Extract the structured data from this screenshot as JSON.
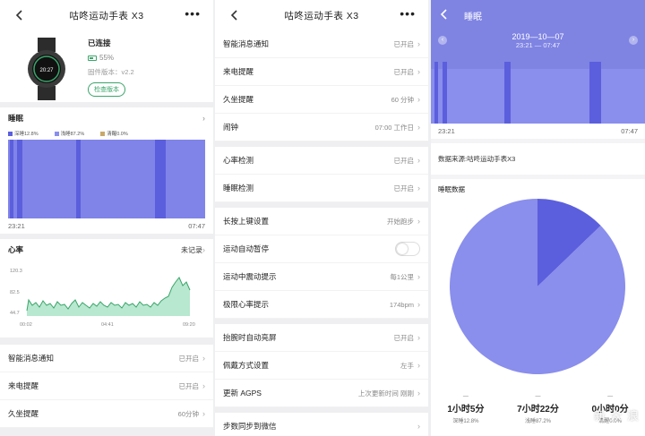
{
  "screen1": {
    "title": "咕咚运动手表 X3",
    "device": {
      "status": "已连接",
      "battery": "55%",
      "firmware": "固件版本：v2.2",
      "check_button": "检查版本",
      "watch_time": "20:27"
    },
    "sleep": {
      "title": "睡眠",
      "legend": [
        "深睡12.8%",
        "浅睡87.2%",
        "清醒0.0%"
      ],
      "start": "23:21",
      "end": "07:47"
    },
    "heart": {
      "title": "心率",
      "status": "未记录",
      "y_top": "120.3",
      "y_mid": "82.5",
      "y_low": "44.7",
      "x_ticks": [
        "00:02",
        "04:41",
        "09:20"
      ]
    },
    "rows": [
      {
        "label": "智能消息通知",
        "value": "已开启"
      },
      {
        "label": "来电提醒",
        "value": "已开启"
      },
      {
        "label": "久坐提醒",
        "value": "60分钟"
      }
    ]
  },
  "screen2": {
    "title": "咕咚运动手表 X3",
    "groups": [
      [
        {
          "label": "智能消息通知",
          "value": "已开启"
        },
        {
          "label": "来电提醒",
          "value": "已开启"
        },
        {
          "label": "久坐提醒",
          "value": "60 分钟"
        },
        {
          "label": "闹钟",
          "value": "07:00 工作日"
        }
      ],
      [
        {
          "label": "心率检测",
          "value": "已开启"
        },
        {
          "label": "睡眠检测",
          "value": "已开启"
        }
      ],
      [
        {
          "label": "长按上键设置",
          "value": "开始跑步"
        },
        {
          "label": "运动自动暂停",
          "value": ""
        },
        {
          "label": "运动中震动提示",
          "value": "每1公里"
        },
        {
          "label": "极限心率提示",
          "value": "174bpm"
        }
      ],
      [
        {
          "label": "抬腕时自动亮屏",
          "value": "已开启"
        },
        {
          "label": "佩戴方式设置",
          "value": "左手"
        },
        {
          "label": "更新 AGPS",
          "value": "上次更新时间 刚刚"
        }
      ],
      [
        {
          "label": "步数同步到微信",
          "value": ""
        }
      ]
    ]
  },
  "screen3": {
    "title": "睡眠",
    "date": "2019—10—07",
    "range": "23:21 — 07:47",
    "start": "23:21",
    "end": "07:47",
    "source": "数据来源:咕咚运动手表X3",
    "section": "睡眠数据",
    "stats": [
      {
        "value": "1小时5分",
        "label": "深睡12.8%"
      },
      {
        "value": "7小时22分",
        "label": "浅睡87.2%"
      },
      {
        "value": "0小时0分",
        "label": "清醒0.0%"
      }
    ],
    "watermark": "新 众 浪"
  },
  "chart_data": [
    {
      "type": "pie",
      "categories": [
        "深睡",
        "浅睡",
        "清醒"
      ],
      "values": [
        12.8,
        87.2,
        0.0
      ],
      "colors": [
        "#5b5fdd",
        "#8a8eec",
        "#c9a96a"
      ]
    }
  ]
}
